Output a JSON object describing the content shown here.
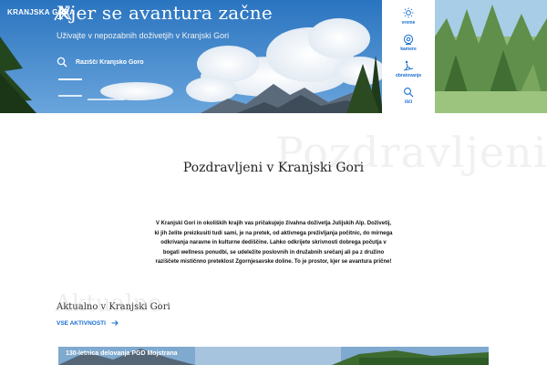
{
  "logo": {
    "text": "KRANJSKA GORA"
  },
  "hero": {
    "title": "Kjer se avantura začne",
    "subtitle": "Uživajte v nepozabnih doživetjih v Kranjski Gori",
    "search_placeholder": "Razišči Kranjsko Goro"
  },
  "sidenav": {
    "items": [
      {
        "label": "vreme",
        "icon": "sun-icon"
      },
      {
        "label": "kamere",
        "icon": "camera-icon"
      },
      {
        "label": "obratovanje",
        "icon": "ski-lift-icon"
      },
      {
        "label": "išči",
        "icon": "search-icon"
      }
    ]
  },
  "welcome": {
    "watermark": "Pozdravljeni",
    "title": "Pozdravljeni v Kranjski Gori",
    "text": "V Kranjski Gori in okoliških krajih vas pričakujejo živahna doživetja Julijskih Alp. Doživetij, ki jih želite preizkusiti tudi sami, je na pretek, od aktivnega preživljanja počitnic, do mirnega odkrivanja naravne in kulturne dediščine. Lahko odkrijete skrivnosti dobrega počutja v bogati wellness ponudbi, se udeležite poslovnih in družabnih srečanj ali pa z družino raziščete mističnno preteklost Zgornjesavske doline. To je prostor, kjer se avantura prične!"
  },
  "aktualno": {
    "watermark": "Aktualno",
    "title": "Aktualno v Kranjski Gori",
    "link_label": "VSE AKTIVNOSTI"
  },
  "news_card": {
    "title": "130-letnica delovanja PGD Mojstrana"
  },
  "colors": {
    "accent": "#1a6fd1",
    "sky": "#2f7bc4"
  }
}
